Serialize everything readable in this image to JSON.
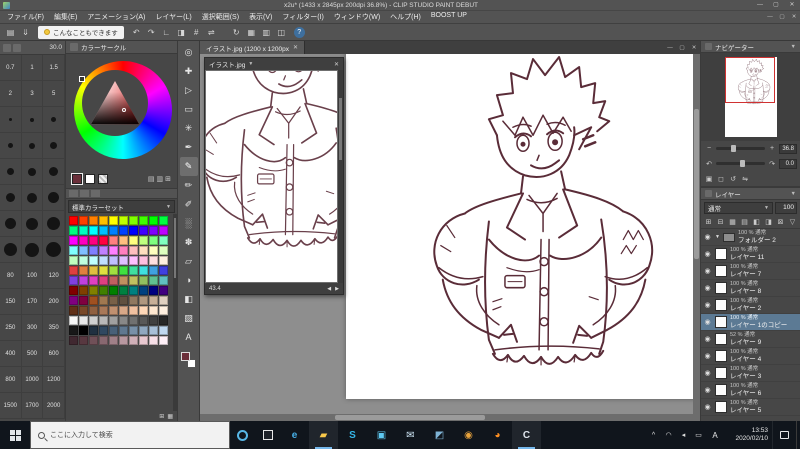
{
  "colors": {
    "ui_dark": "#535353",
    "panel": "#474747",
    "canvas_gray": "#8e8e8e",
    "sketch_line": "#5a2c38",
    "selection_blue": "#5c7a94",
    "nav_view_red": "#d03232",
    "taskbar": "#10151c",
    "accent": "#76b9ed",
    "fg_color": "#6b2f3a"
  },
  "glyphs": {
    "close": "✕",
    "minimize": "—",
    "maximize": "▢",
    "dropdown": "▼",
    "left": "◀",
    "right": "▶",
    "plus": "+",
    "minus": "−",
    "rot_left": "↶",
    "rot_right": "↷",
    "eye": "◉"
  },
  "titlebar": {
    "title": "x2u* (1433 x 2845px 200dpi 36.8%) - CLIP STUDIO PAINT DEBUT"
  },
  "menubar": {
    "items": [
      "ファイル(F)",
      "編集(E)",
      "アニメーション(A)",
      "レイヤー(L)",
      "選択範囲(S)",
      "表示(V)",
      "フィルター(I)",
      "ウィンドウ(W)",
      "ヘルプ(H)",
      "BOOST UP"
    ]
  },
  "commandbar": {
    "tip_text": "こんなこともできます",
    "help_label": "?",
    "left_icons": [
      {
        "name": "new-canvas-icon",
        "glyph": "▤"
      },
      {
        "name": "save-icon",
        "glyph": "⇓"
      }
    ],
    "mid_icons": [
      {
        "name": "undo-icon",
        "glyph": "↶"
      },
      {
        "name": "redo-icon",
        "glyph": "↷"
      },
      {
        "name": "snap-ruler-icon",
        "glyph": "∟"
      },
      {
        "name": "snap-special-ruler-icon",
        "glyph": "◨"
      },
      {
        "name": "snap-grid-icon",
        "glyph": "#"
      },
      {
        "name": "flip-horizontal-icon",
        "glyph": "⇌"
      }
    ],
    "right_icons": [
      {
        "name": "rotate-view-icon",
        "glyph": "↻"
      },
      {
        "name": "grid-icon",
        "glyph": "▦"
      },
      {
        "name": "material-icon",
        "glyph": "▥"
      },
      {
        "name": "snapshot-icon",
        "glyph": "◫"
      }
    ]
  },
  "brush_palette": {
    "current_size": "30.0",
    "rows": [
      {
        "labels": [
          "0.7",
          "1",
          "1.5"
        ],
        "dot": 0
      },
      {
        "labels": [
          "2",
          "3",
          "5"
        ],
        "dot": 0
      },
      {
        "labels": [
          "",
          "",
          ""
        ],
        "dot": 3
      },
      {
        "labels": [
          "",
          "",
          ""
        ],
        "dot": 5
      },
      {
        "labels": [
          "",
          "",
          ""
        ],
        "dot": 7
      },
      {
        "labels": [
          "",
          "",
          ""
        ],
        "dot": 9
      },
      {
        "labels": [
          "",
          "",
          ""
        ],
        "dot": 11
      },
      {
        "labels": [
          "",
          "",
          ""
        ],
        "dot": 13
      },
      {
        "labels": [
          "80",
          "100",
          "120"
        ],
        "dot": 0
      },
      {
        "labels": [
          "150",
          "170",
          "200"
        ],
        "dot": 0
      },
      {
        "labels": [
          "250",
          "300",
          "350"
        ],
        "dot": 0
      },
      {
        "labels": [
          "400",
          "500",
          "600"
        ],
        "dot": 0
      },
      {
        "labels": [
          "800",
          "1000",
          "1200"
        ],
        "dot": 0
      },
      {
        "labels": [
          "1500",
          "1700",
          "2000"
        ],
        "dot": 0
      }
    ]
  },
  "color_wheel": {
    "title": "カラーサークル",
    "icon_row": [
      "▤",
      "▥",
      "⊞"
    ]
  },
  "color_set": {
    "selected": "標準カラーセット",
    "bottom_icons": [
      "⊞",
      "▦"
    ],
    "colors": [
      "#ff0000",
      "#ff4000",
      "#ff8000",
      "#ffbf00",
      "#ffff00",
      "#bfff00",
      "#80ff00",
      "#40ff00",
      "#00ff00",
      "#00ff40",
      "#00ff80",
      "#00ffbf",
      "#00ffff",
      "#00bfff",
      "#0080ff",
      "#0040ff",
      "#0000ff",
      "#4000ff",
      "#8000ff",
      "#bf00ff",
      "#ff00ff",
      "#ff00bf",
      "#ff0080",
      "#ff0040",
      "#ff8080",
      "#ffbf80",
      "#ffff80",
      "#bfff80",
      "#80ff80",
      "#80ffbf",
      "#80ffff",
      "#80bfff",
      "#8080ff",
      "#bf80ff",
      "#ff80ff",
      "#ff80bf",
      "#ffbfbf",
      "#ffdfbf",
      "#ffffbf",
      "#dfffbf",
      "#bfffbf",
      "#bfffdf",
      "#bfffff",
      "#bfdfff",
      "#bfbfff",
      "#dfbfff",
      "#ffbfff",
      "#ffbfdf",
      "#ffdfdf",
      "#fff0df",
      "#df4040",
      "#df8040",
      "#dfbf40",
      "#dfdf40",
      "#a0df40",
      "#40df40",
      "#40dfa0",
      "#40dfdf",
      "#40a0df",
      "#4040df",
      "#8040df",
      "#c040df",
      "#df40c0",
      "#df4080",
      "#c06060",
      "#c09060",
      "#c0c060",
      "#90c060",
      "#60c090",
      "#60c0c0",
      "#800000",
      "#804000",
      "#808000",
      "#408000",
      "#008000",
      "#008040",
      "#008080",
      "#004080",
      "#000080",
      "#400080",
      "#800080",
      "#800040",
      "#a05020",
      "#a07850",
      "#786048",
      "#605040",
      "#907860",
      "#b09880",
      "#c8b098",
      "#e0d0c0",
      "#603018",
      "#784828",
      "#906040",
      "#a87858",
      "#c09070",
      "#d8a888",
      "#f0c0a0",
      "#ffd8b8",
      "#ffe8d0",
      "#fff0e0",
      "#f8f8f8",
      "#e8e8e8",
      "#d0d0d0",
      "#b8b8b8",
      "#a0a0a0",
      "#888888",
      "#707070",
      "#585858",
      "#404040",
      "#282828",
      "#181818",
      "#000000",
      "#203040",
      "#304860",
      "#486078",
      "#607890",
      "#7890a8",
      "#90a8c0",
      "#a8c0d8",
      "#c0d8f0",
      "#402830",
      "#583840",
      "#705058",
      "#886870",
      "#a08088",
      "#b898a0",
      "#d0b0b8",
      "#e8c8d0",
      "#f8e0e8",
      "#fff0f8"
    ]
  },
  "toolbar": {
    "tools": [
      {
        "name": "zoom-tool",
        "glyph": "◎"
      },
      {
        "name": "move-tool",
        "glyph": "✚"
      },
      {
        "name": "operation-tool",
        "glyph": "▷"
      },
      {
        "name": "selection-tool",
        "glyph": "▭"
      },
      {
        "name": "auto-select-tool",
        "glyph": "✳"
      },
      {
        "name": "eyedropper-tool",
        "glyph": "✒"
      },
      {
        "name": "pen-tool",
        "glyph": "✎",
        "selected": true
      },
      {
        "name": "pencil-tool",
        "glyph": "✏"
      },
      {
        "name": "brush-tool",
        "glyph": "✐"
      },
      {
        "name": "airbrush-tool",
        "glyph": "░"
      },
      {
        "name": "decoration-tool",
        "glyph": "✽"
      },
      {
        "name": "eraser-tool",
        "glyph": "▱"
      },
      {
        "name": "blend-tool",
        "glyph": "◑"
      },
      {
        "name": "fill-tool",
        "glyph": "◧"
      },
      {
        "name": "gradient-tool",
        "glyph": "▨"
      },
      {
        "name": "text-tool",
        "glyph": "A"
      }
    ]
  },
  "document_tab": {
    "label": "イラスト.jpg (1200 x 1200px"
  },
  "float_window": {
    "tab": "イラスト.jpg",
    "zoom": "43.4"
  },
  "navigator": {
    "title": "ナビゲーター",
    "zoom": "36.8",
    "rotate": "0.0",
    "extra_buttons": [
      "▣",
      "◻",
      "↺",
      "⇋"
    ]
  },
  "layers": {
    "title": "レイヤー",
    "blend_mode": "通常",
    "opacity": "100",
    "icon_row": [
      "⊞",
      "⊟",
      "▦",
      "▤",
      "◧",
      "◨",
      "⊠",
      "▽"
    ],
    "items": [
      {
        "info": "100 % 通常",
        "name": "フォルダー 2",
        "type": "folder",
        "selected": false
      },
      {
        "info": "100 % 通常",
        "name": "レイヤー 11",
        "type": "layer",
        "selected": false
      },
      {
        "info": "100 % 通常",
        "name": "レイヤー 7",
        "type": "layer",
        "selected": false
      },
      {
        "info": "100 % 通常",
        "name": "レイヤー 8",
        "type": "layer",
        "selected": false
      },
      {
        "info": "100 % 通常",
        "name": "レイヤー 2",
        "type": "layer",
        "selected": false
      },
      {
        "info": "100 % 通常",
        "name": "レイヤー 1のコピー",
        "type": "layer",
        "selected": true
      },
      {
        "info": "52 % 通常",
        "name": "レイヤー 9",
        "type": "layer",
        "selected": false
      },
      {
        "info": "100 % 通常",
        "name": "レイヤー 4",
        "type": "layer",
        "selected": false
      },
      {
        "info": "100 % 通常",
        "name": "レイヤー 3",
        "type": "layer",
        "selected": false
      },
      {
        "info": "100 % 通常",
        "name": "レイヤー 6",
        "type": "layer",
        "selected": false
      },
      {
        "info": "100 % 通常",
        "name": "レイヤー 5",
        "type": "layer",
        "selected": false
      }
    ]
  },
  "taskbar": {
    "search_placeholder": "ここに入力して検索",
    "ime": "A",
    "time": "13:53",
    "date": "2020/02/10",
    "apps": [
      {
        "name": "edge",
        "glyph": "e",
        "color": "#47b0e8",
        "active": false
      },
      {
        "name": "explorer",
        "glyph": "▰",
        "color": "#f8c84a",
        "active": true
      },
      {
        "name": "skype",
        "glyph": "S",
        "color": "#35b6e8",
        "active": false
      },
      {
        "name": "store",
        "glyph": "▣",
        "color": "#5fc9f2",
        "active": false
      },
      {
        "name": "mail",
        "glyph": "✉",
        "color": "#cfe6f5",
        "active": false
      },
      {
        "name": "photos",
        "glyph": "◩",
        "color": "#7fb3d5",
        "active": false
      },
      {
        "name": "chrome",
        "glyph": "◉",
        "color": "#e8a33c",
        "active": false
      },
      {
        "name": "firefox",
        "glyph": "◕",
        "color": "#ff9022",
        "active": false
      },
      {
        "name": "clip-studio",
        "glyph": "C",
        "color": "#dfe6ee",
        "active": true
      }
    ],
    "tray_icons": [
      {
        "name": "tray-expand-icon",
        "glyph": "^"
      },
      {
        "name": "network-icon",
        "glyph": "◠"
      },
      {
        "name": "volume-icon",
        "glyph": "◂"
      },
      {
        "name": "battery-icon",
        "glyph": "▭"
      }
    ]
  }
}
